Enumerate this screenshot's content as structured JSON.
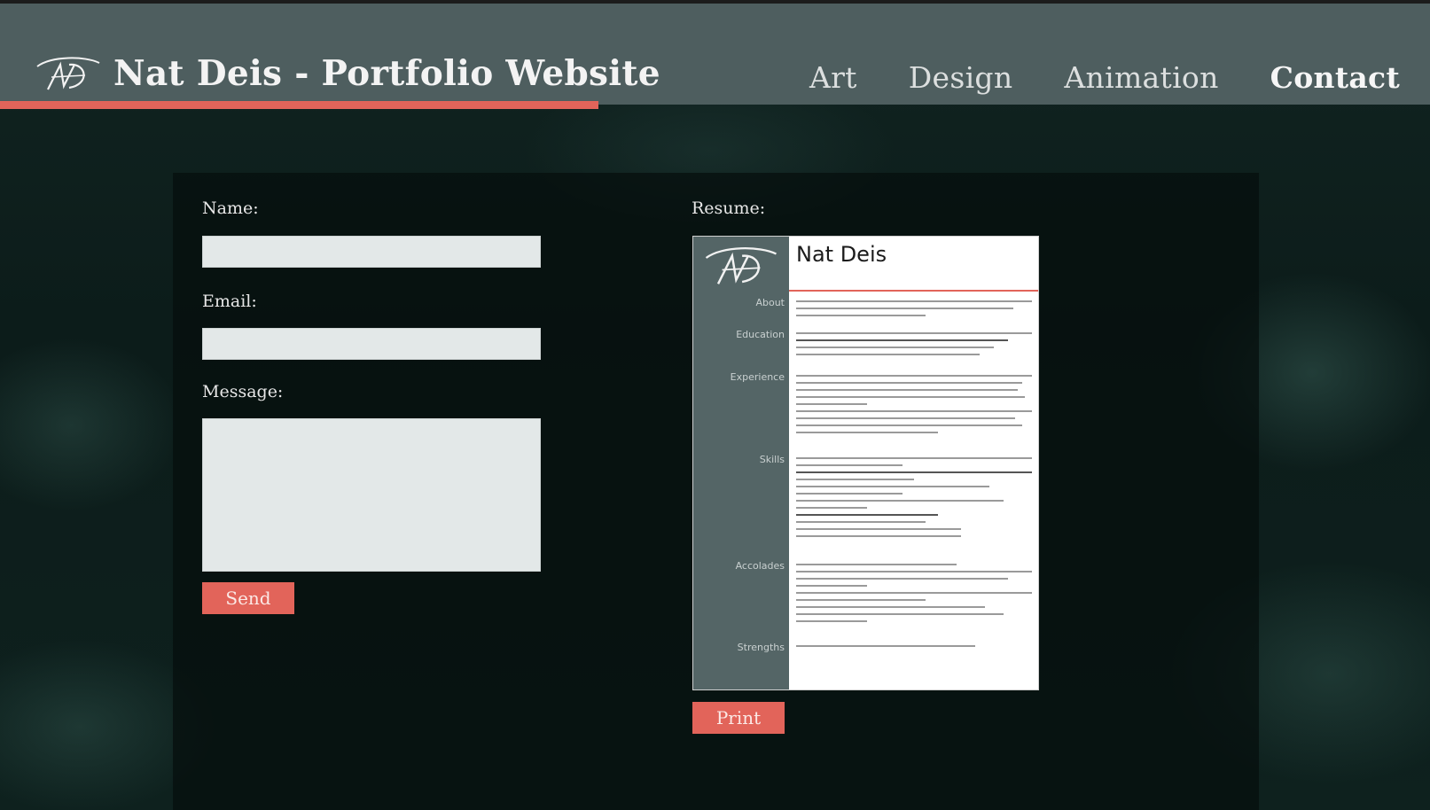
{
  "header": {
    "title": "Nat Deis - Portfolio Website",
    "nav": [
      {
        "label": "Art",
        "active": false
      },
      {
        "label": "Design",
        "active": false
      },
      {
        "label": "Animation",
        "active": false
      },
      {
        "label": "Contact",
        "active": true
      }
    ],
    "underline_color": "#e2645a"
  },
  "contact_form": {
    "name_label": "Name:",
    "name_value": "",
    "email_label": "Email:",
    "email_value": "",
    "message_label": "Message:",
    "message_value": "",
    "send_label": "Send"
  },
  "resume": {
    "label": "Resume:",
    "name": "Nat Deis",
    "sections": [
      "About",
      "Education",
      "Experience",
      "Skills",
      "Accolades",
      "Strengths"
    ],
    "print_label": "Print"
  },
  "colors": {
    "accent": "#e2645a",
    "header_bg": "#4e5e5f",
    "page_bg": "#0a1514",
    "field_bg": "#e3e8e8"
  },
  "icons": [
    "nd-monogram-logo"
  ]
}
